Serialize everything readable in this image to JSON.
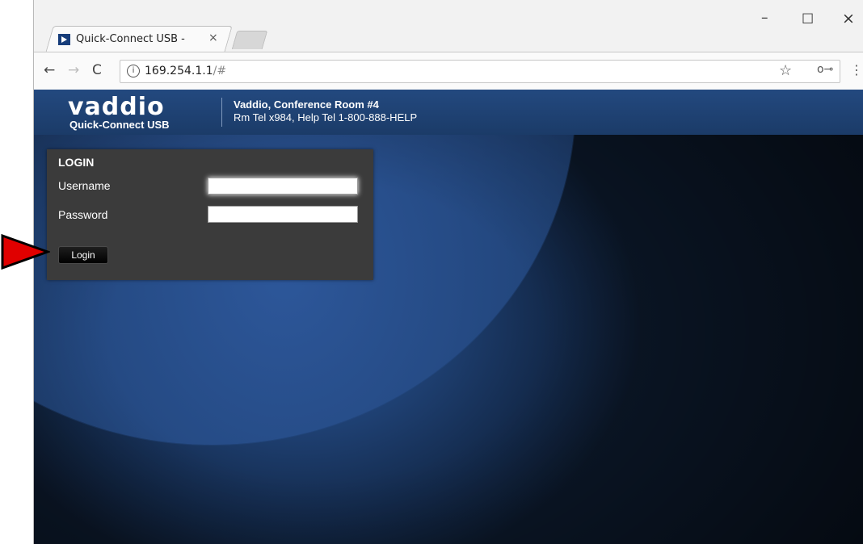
{
  "browser": {
    "tab_title": "Quick-Connect USB -",
    "tab_close": "×",
    "url_host": "169.254.1.1",
    "url_path": "/#",
    "info_glyph": "i",
    "minimize": "–",
    "maximize": "☐",
    "close": "×",
    "back": "←",
    "forward": "→",
    "reload": "C",
    "key_glyph": "o⊸",
    "star_glyph": "☆",
    "menu_glyph": "⋮",
    "icons": [
      "vaddio-favicon",
      "info-icon",
      "key-icon",
      "star-icon",
      "menu-icon"
    ]
  },
  "header": {
    "logo_word": "vaddio",
    "logo_sub": "Quick-Connect USB",
    "room_name": "Vaddio, Conference Room #4",
    "room_tel": "Rm Tel x984, Help Tel 1-800-888-HELP"
  },
  "login": {
    "title": "LOGIN",
    "username_label": "Username",
    "password_label": "Password",
    "username_value": "",
    "password_value": "",
    "button_label": "Login"
  },
  "annotation": {
    "arrow_color": "#e00000"
  }
}
